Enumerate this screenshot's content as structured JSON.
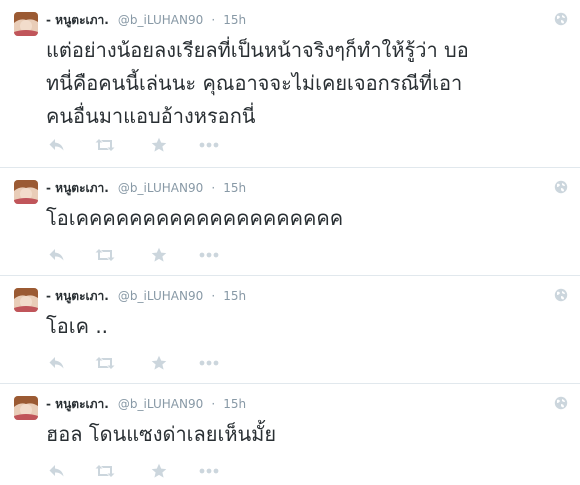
{
  "tweets": [
    {
      "name": "- หนูตะเภา.",
      "handle": "@b_iLUHAN90",
      "separator": "·",
      "time": "15h",
      "text": "แต่อย่างน้อยลงเรียลที่เป็นหน้าจริงๆก็ทำให้รู้ว่า บอ\nทนี่คือคนนี้เล่นนะ คุณอาจจะไม่เคยเจอกรณีที่เอา\nคนอื่นมาแอบอ้างหรอกนี่"
    },
    {
      "name": "- หนูตะเภา.",
      "handle": "@b_iLUHAN90",
      "separator": "·",
      "time": "15h",
      "text": "โอเคคคคคคคคคคคคคคคคคคคค"
    },
    {
      "name": "- หนูตะเภา.",
      "handle": "@b_iLUHAN90",
      "separator": "·",
      "time": "15h",
      "text": "โอเค .."
    },
    {
      "name": "- หนูตะเภา.",
      "handle": "@b_iLUHAN90",
      "separator": "·",
      "time": "15h",
      "text": "ฮอล โดนแซงด่าเลยเห็นมั้ย"
    }
  ],
  "icons": {
    "reply": "reply-icon",
    "retweet": "retweet-icon",
    "favorite": "star-icon",
    "more": "more-icon",
    "globe": "globe-icon"
  },
  "colors": {
    "text": "#292f33",
    "muted": "#8899a6",
    "icon": "#ccd6dd",
    "divider": "#e1e8ed"
  }
}
